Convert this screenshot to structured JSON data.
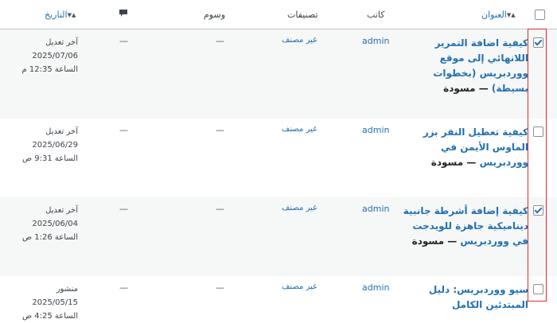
{
  "header": {
    "title": "العنوان",
    "author": "كاتب",
    "categories": "تصنيفات",
    "tags": "وسوم",
    "date": "التاريخ"
  },
  "colors": {
    "link": "#2271b1",
    "highlight": "#e02a2a"
  },
  "rows": [
    {
      "title": "كيفية اضافة التمرير اللانهائي إلى موقع ووردبريس (بخطوات بسيطة)",
      "state": "— مسودة",
      "author": "admin",
      "category": "غير مصنف",
      "tags": "—",
      "comments": "—",
      "date_status": "آخر تعديل",
      "date": "2025/07/06",
      "time": "الساعة 12:35 م",
      "checked": true
    },
    {
      "title": "كيفية تعطيل النقر بزر الماوس الأيمن في ووردبريس",
      "state": "— مسودة",
      "author": "admin",
      "category": "غير مصنف",
      "tags": "—",
      "comments": "—",
      "date_status": "آخر تعديل",
      "date": "2025/06/29",
      "time": "الساعة 9:31 ص",
      "checked": false
    },
    {
      "title": "كيفية إضافة أشرطة جانبية ديناميكية جاهزة للويدجت في ووردبريس",
      "state": "— مسودة",
      "author": "admin",
      "category": "غير مصنف",
      "tags": "—",
      "comments": "—",
      "date_status": "آخر تعديل",
      "date": "2025/06/04",
      "time": "الساعة 1:26 ص",
      "checked": true
    },
    {
      "title": "سيو ووردبريس: دليل المبتدئين الكامل",
      "state": "",
      "author": "admin",
      "category": "غير مصنف",
      "tags": "—",
      "comments": "—",
      "date_status": "منشور",
      "date": "2025/05/15",
      "time": "الساعة 4:25 ص",
      "checked": false
    }
  ]
}
